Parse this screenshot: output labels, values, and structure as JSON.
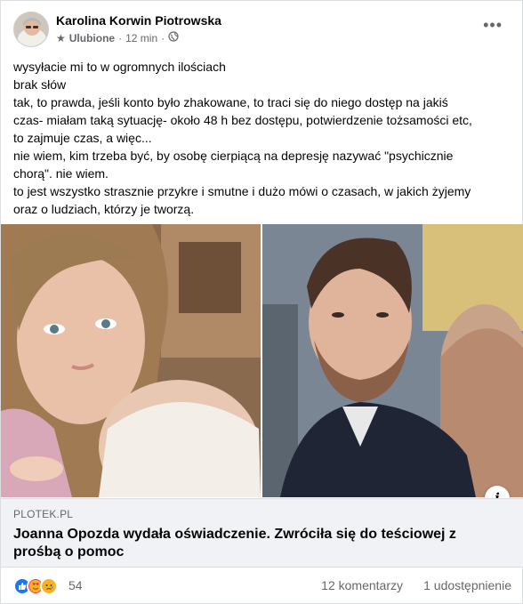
{
  "post": {
    "author": "Karolina Korwin Piotrowska",
    "audience": "Ulubione",
    "time": "12 min",
    "text_lines": [
      "wysyłacie mi to w ogromnych ilościach",
      "brak słów",
      "tak, to prawda, jeśli konto było zhakowane, to traci się do niego dostęp na jakiś",
      "czas- miałam taką sytuację- około 48 h bez dostępu, potwierdzenie tożsamości etc,",
      "to zajmuje czas, a więc...",
      "nie wiem, kim trzeba być, by osobę cierpiącą na depresję nazywać \"psychicznie",
      "chorą\". nie wiem.",
      "to jest wszystko strasznie przykre i smutne i dużo mówi o czasach, w jakich żyjemy",
      "oraz o ludziach, którzy je tworzą."
    ]
  },
  "link": {
    "domain": "PLOTEK.PL",
    "title": "Joanna Opozda wydała oświadczenie. Zwróciła się do teściowej z prośbą o pomoc"
  },
  "stats": {
    "reactions_count": "54",
    "comments": "12 komentarzy",
    "shares": "1 udostępnienie"
  },
  "icons": {
    "audience": "star-icon",
    "privacy": "globe-icon",
    "menu": "more-options-icon",
    "info": "info-icon",
    "reactions": [
      "like-icon",
      "love-icon",
      "sad-icon"
    ]
  },
  "colors": {
    "meta_text": "#65676b",
    "like": "#1877f2",
    "love": "#f33e58",
    "sad": "#f7b125",
    "link_bg": "#f0f2f5"
  }
}
